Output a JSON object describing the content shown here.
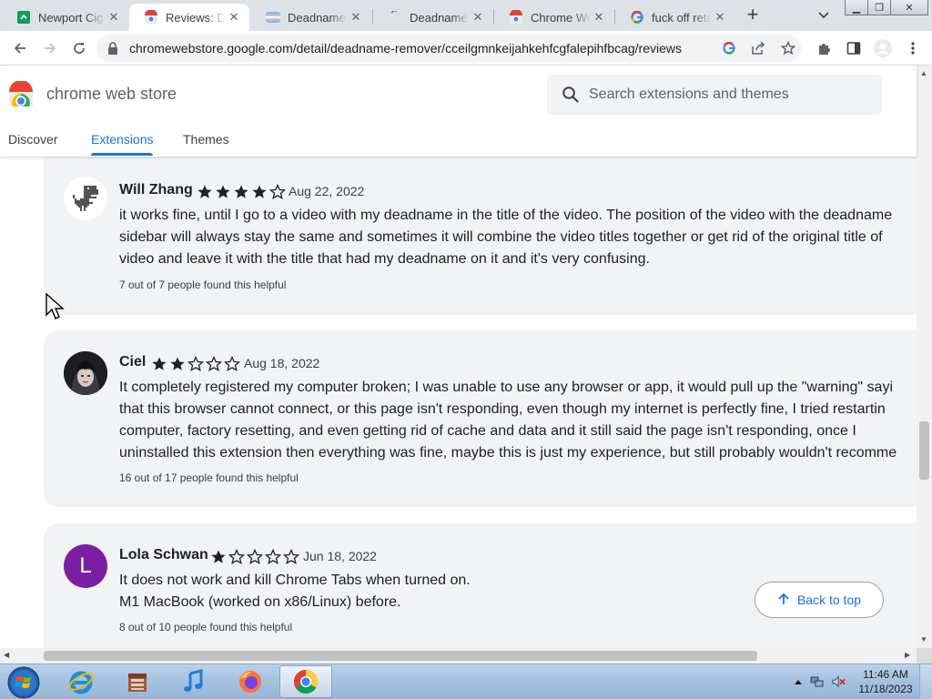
{
  "browser": {
    "tabs": [
      {
        "title": "Newport Cig",
        "favicon": "green-sheet-icon",
        "active": false
      },
      {
        "title": "Reviews: Dea",
        "favicon": "chrome-webstore-icon",
        "active": true
      },
      {
        "title": "Deadname R",
        "favicon": "trans-flag-icon",
        "active": false
      },
      {
        "title": "Deadname R",
        "favicon": "page-icon",
        "active": false
      },
      {
        "title": "Chrome Web",
        "favicon": "chrome-webstore-icon",
        "active": false
      },
      {
        "title": "fuck off retar",
        "favicon": "google-icon",
        "active": false
      }
    ],
    "url": "chromewebstore.google.com/detail/deadname-remover/cceilgmnkeijahkehfcgfalepihfbcag/reviews"
  },
  "store": {
    "name": "chrome web store",
    "search_placeholder": "Search extensions and themes",
    "nav": [
      {
        "label": "Discover",
        "active": false
      },
      {
        "label": "Extensions",
        "active": true
      },
      {
        "label": "Themes",
        "active": false
      }
    ]
  },
  "reviews": [
    {
      "author": "Will Zhang",
      "rating": 4,
      "date": "Aug 22, 2022",
      "lines": [
        "it works fine, until I go to a video with my deadname in the title of the video. The position of the video with the deadname",
        "sidebar will always stay the same and sometimes it will combine the video titles together or get rid of the original title of",
        "video and leave it with the title that had my deadname on it and it's very confusing."
      ],
      "helpful": "7 out of 7 people found this helpful",
      "avatar": "dino-avatar"
    },
    {
      "author": "Ciel",
      "rating": 2,
      "date": "Aug 18, 2022",
      "lines": [
        "It completely registered my computer broken; I was unable to use any browser or app, it would pull up the \"warning\" sayi",
        "that this browser cannot connect, or this page isn't responding, even though my internet is perfectly fine, I tried restartin",
        "computer, factory resetting, and even getting rid of cache and data and it still said the page isn't responding, once I",
        "uninstalled this extension then everything was fine, maybe this is just my experience, but still probably wouldn't recomme"
      ],
      "helpful": "16 out of 17 people found this helpful",
      "avatar": "photo-avatar"
    },
    {
      "author": "Lola Schwan",
      "rating": 1,
      "date": "Jun 18, 2022",
      "lines": [
        "It does not work and kill Chrome Tabs when turned on.",
        "M1 MacBook (worked on x86/Linux) before."
      ],
      "helpful": "8 out of 10 people found this helpful",
      "avatar": "letter-avatar",
      "initial": "L",
      "avatar_color": "#7b1fa2"
    }
  ],
  "back_to_top": "Back to top",
  "taskbar": {
    "apps": [
      "internet-explorer-icon",
      "archive-icon",
      "music-icon",
      "firefox-icon",
      "chrome-icon"
    ],
    "time": "11:46 AM",
    "date": "11/18/2023"
  },
  "colors": {
    "accent": "#1a73e8",
    "card_bg": "#f1f3f4",
    "star": "#202124"
  }
}
